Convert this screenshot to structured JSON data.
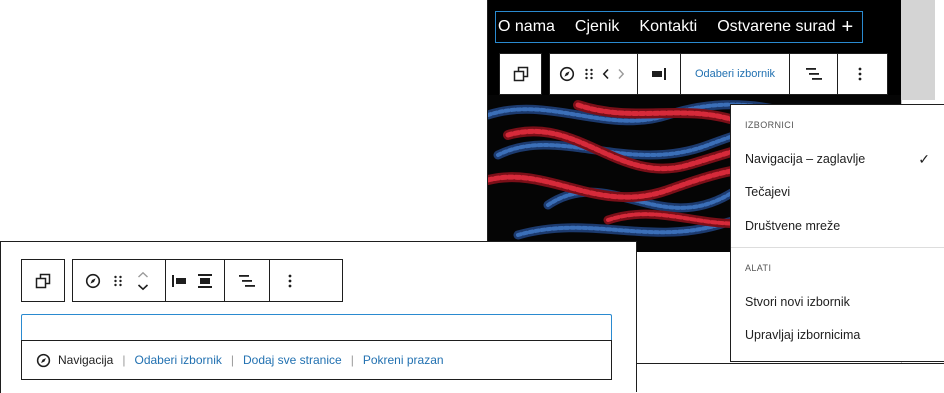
{
  "editor": {
    "nav_items": [
      "O nama",
      "Cjenik",
      "Kontakti",
      "Ostvarene surad"
    ],
    "add_symbol": "+",
    "toolbar": {
      "choose_menu_label": "Odaberi izbornik"
    },
    "dropdown": {
      "menus_heading": "IZBORNICI",
      "menus": [
        {
          "label": "Navigacija – zaglavlje",
          "selected": true
        },
        {
          "label": "Tečajevi",
          "selected": false
        },
        {
          "label": "Društvene mreže",
          "selected": false
        }
      ],
      "check_mark": "✓",
      "tools_heading": "ALATI",
      "tools": [
        "Stvori novi izbornik",
        "Upravljaj izbornicima"
      ]
    }
  },
  "block": {
    "placeholder": {
      "label": "Navigacija",
      "links": [
        "Odaberi izbornik",
        "Dodaj sve stranice",
        "Pokreni prazan"
      ],
      "separator": "|"
    }
  },
  "colors": {
    "accent": "#2271b1",
    "focus_outline": "#2a8ad0",
    "border": "#1e1e1e"
  }
}
